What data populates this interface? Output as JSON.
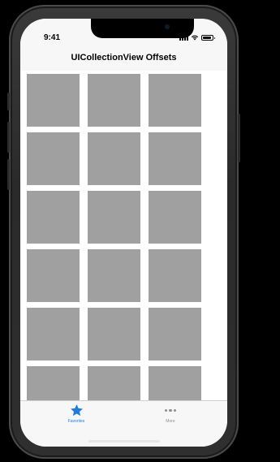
{
  "status_bar": {
    "time": "9:41"
  },
  "nav_bar": {
    "title": "UICollectionView Offsets"
  },
  "collection": {
    "cell_color": "#a0a0a0",
    "columns": 3,
    "visible_cell_count": 18
  },
  "tab_bar": {
    "tabs": [
      {
        "label": "Favorites",
        "icon": "star-icon",
        "selected": true
      },
      {
        "label": "More",
        "icon": "more-icon",
        "selected": false
      }
    ],
    "selected_color": "#1e7be0",
    "unselected_color": "#8e8e93"
  }
}
